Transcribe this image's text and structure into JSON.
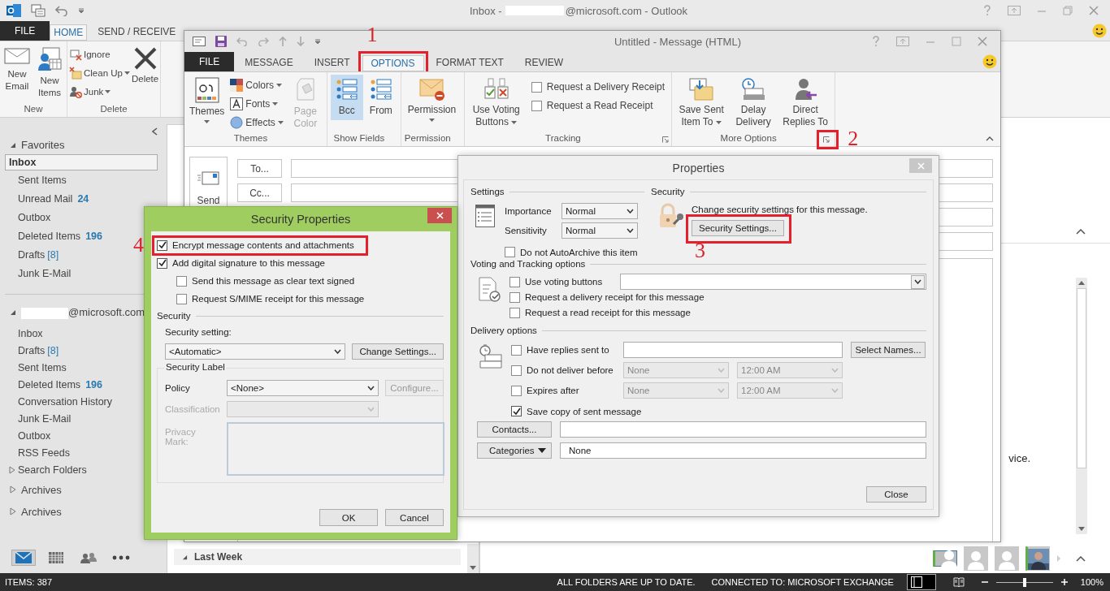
{
  "outlook": {
    "title_before": "Inbox -",
    "title_after": "@microsoft.com - Outlook",
    "tabs": [
      {
        "label": "FILE",
        "kind": "file",
        "selected": false
      },
      {
        "label": "HOME",
        "kind": "tab",
        "selected": true
      },
      {
        "label": "SEND / RECEIVE",
        "kind": "tab",
        "selected": false
      }
    ],
    "ribbon": {
      "new": {
        "label": "New",
        "buttons": [
          "New Email",
          "New Items"
        ]
      },
      "delete": {
        "label": "Delete",
        "commands": [
          "Ignore",
          "Clean Up",
          "Junk"
        ],
        "delete": "Delete"
      }
    },
    "sidebar": {
      "sections": [
        {
          "label": "Favorites",
          "expanded": true,
          "redacted": false,
          "items": [
            {
              "label": "Inbox",
              "selected": true
            },
            {
              "label": "Sent Items",
              "selected": false
            },
            {
              "label": "Unread Mail",
              "count": "24",
              "count_bold": true,
              "selected": false
            },
            {
              "label": "Outbox",
              "selected": false
            },
            {
              "label": "Deleted Items",
              "count": "196",
              "count_bold": true,
              "selected": false
            },
            {
              "label": "Drafts",
              "count": "[8]",
              "count_bold": false,
              "selected": false
            },
            {
              "label": "Junk E-Mail",
              "selected": false
            }
          ]
        },
        {
          "label": "@microsoft.com",
          "expanded": true,
          "redacted": true,
          "items": [
            {
              "label": "Inbox",
              "kind": "folder",
              "selected": false
            },
            {
              "label": "Drafts",
              "count": "[8]",
              "count_bold": false,
              "kind": "folder",
              "selected": false
            },
            {
              "label": "Sent Items",
              "kind": "folder",
              "selected": false
            },
            {
              "label": "Deleted Items",
              "count": "196",
              "count_bold": true,
              "kind": "folder",
              "selected": false
            },
            {
              "label": "Conversation History",
              "kind": "folder",
              "selected": false
            },
            {
              "label": "Junk E-Mail",
              "kind": "folder",
              "selected": false
            },
            {
              "label": "Outbox",
              "kind": "folder",
              "selected": false
            },
            {
              "label": "RSS Feeds",
              "kind": "folder",
              "selected": false
            },
            {
              "label": "Search Folders",
              "kind": "group",
              "selected": false
            }
          ]
        },
        {
          "label": "Archives",
          "expanded": false,
          "redacted": false
        },
        {
          "label": "Archives",
          "expanded": false,
          "redacted": false
        }
      ]
    },
    "nav": [
      {
        "kind": "mail",
        "selected": true
      },
      {
        "kind": "calendar",
        "selected": false
      },
      {
        "kind": "people",
        "selected": false
      },
      {
        "kind": "more",
        "selected": false
      }
    ],
    "message_list": {
      "group": "Last Week"
    },
    "reading_pane": {
      "text": "vice."
    },
    "people_pane": [
      {
        "kind": "contact",
        "selected": true
      },
      {
        "kind": "contact",
        "selected": false
      },
      {
        "kind": "contact",
        "selected": false
      },
      {
        "kind": "photo",
        "selected": false
      }
    ],
    "status": {
      "items": "ITEMS: 387",
      "sync": "ALL FOLDERS ARE UP TO DATE.",
      "connection": "CONNECTED TO: MICROSOFT EXCHANGE",
      "zoom": {
        "level": 0.5,
        "reading": "100%"
      }
    }
  },
  "message_window": {
    "title": "Untitled - Message (HTML)",
    "tabs": [
      {
        "label": "FILE",
        "kind": "file",
        "selected": false
      },
      {
        "label": "MESSAGE",
        "kind": "tab",
        "selected": false
      },
      {
        "label": "INSERT",
        "kind": "tab",
        "selected": false
      },
      {
        "label": "OPTIONS",
        "kind": "tab",
        "selected": true,
        "annotation": "1"
      },
      {
        "label": "FORMAT TEXT",
        "kind": "tab",
        "selected": false
      },
      {
        "label": "REVIEW",
        "kind": "tab",
        "selected": false
      }
    ],
    "themes": {
      "label": "Themes",
      "button": "Themes",
      "commands": [
        "Colors",
        "Fonts",
        "Effects"
      ],
      "page_color": {
        "label": "Page Color",
        "disabled": true
      }
    },
    "show_fields": {
      "label": "Show Fields",
      "buttons": [
        {
          "label": "Bcc",
          "selected": true
        },
        {
          "label": "From",
          "selected": false
        }
      ]
    },
    "permission": {
      "label": "Permission",
      "button": "Permission"
    },
    "tracking": {
      "label": "Tracking",
      "voting": "Use Voting Buttons",
      "checks": [
        {
          "label": "Request a Delivery Receipt",
          "checked": false
        },
        {
          "label": "Request a Read Receipt",
          "checked": false
        }
      ]
    },
    "more_options": {
      "label": "More Options",
      "buttons": [
        "Save Sent Item To",
        "Delay Delivery",
        "Direct Replies To"
      ],
      "launcher_annotation": "2"
    },
    "compose": {
      "send": "Send",
      "to": "To...",
      "cc": "Cc..."
    }
  },
  "properties": {
    "title": "Properties",
    "settings": {
      "label": "Settings",
      "importance": {
        "label": "Importance",
        "value": "Normal"
      },
      "sensitivity": {
        "label": "Sensitivity",
        "value": "Normal"
      },
      "autoarchive": {
        "label": "Do not AutoArchive this item",
        "checked": false
      }
    },
    "security": {
      "label": "Security",
      "text": "Change security settings for this message.",
      "button": "Security Settings...",
      "annotation": "3"
    },
    "voting": {
      "label": "Voting and Tracking options",
      "checks": [
        {
          "label": "Use voting buttons",
          "checked": false
        },
        {
          "label": "Request a delivery receipt for this message",
          "checked": false
        },
        {
          "label": "Request a read receipt for this message",
          "checked": false
        }
      ]
    },
    "delivery": {
      "label": "Delivery options",
      "replies": {
        "label": "Have replies sent to",
        "checked": false,
        "button": "Select Names..."
      },
      "not_before": {
        "label": "Do not deliver before",
        "checked": false,
        "date": "None",
        "time": "12:00 AM"
      },
      "expires": {
        "label": "Expires after",
        "checked": false,
        "date": "None",
        "time": "12:00 AM"
      },
      "save_copy": {
        "label": "Save copy of sent message",
        "checked": true
      }
    },
    "contacts": "Contacts...",
    "categories": {
      "label": "Categories",
      "value": "None"
    },
    "close": "Close"
  },
  "security_properties": {
    "title": "Security Properties",
    "options": [
      {
        "label": "Encrypt message contents and attachments",
        "checked": true,
        "annotation": "4"
      },
      {
        "label": "Add digital signature to this message",
        "checked": true,
        "children": [
          {
            "label": "Send this message as clear text signed",
            "checked": false
          },
          {
            "label": "Request S/MIME receipt for this message",
            "checked": false
          }
        ]
      }
    ],
    "security": {
      "label": "Security",
      "setting_label": "Security setting:",
      "setting": "<Automatic>",
      "change": "Change Settings..."
    },
    "security_label": {
      "label": "Security Label",
      "policy": {
        "label": "Policy",
        "value": "<None>"
      },
      "configure": {
        "label": "Configure...",
        "disabled": true
      },
      "classification": {
        "label": "Classification",
        "disabled": true
      },
      "privacy": {
        "label": "Privacy Mark:",
        "disabled": true
      }
    },
    "ok": "OK",
    "cancel": "Cancel"
  }
}
